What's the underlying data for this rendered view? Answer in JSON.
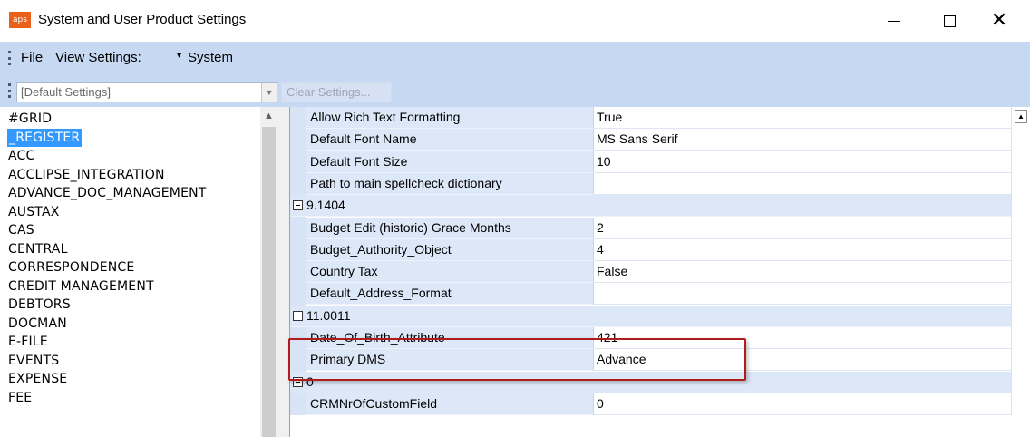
{
  "window": {
    "title": "System and User Product Settings",
    "logo_text": "aps",
    "accent_color": "#e8601c"
  },
  "menubar": {
    "file": "File",
    "view_settings_underlined": "V",
    "view_settings_rest": "iew Settings:",
    "dropdown_arrow": "▾",
    "system": "System"
  },
  "toolbar": {
    "settings_combo_value": "[Default Settings]",
    "clear_settings": "Clear Settings..."
  },
  "products": {
    "items": [
      "#GRID",
      "_REGISTER",
      "ACC",
      "ACCLIPSE_INTEGRATION",
      "ADVANCE_DOC_MANAGEMENT",
      "AUSTAX",
      "CAS",
      "CENTRAL",
      "CORRESPONDENCE",
      "CREDIT MANAGEMENT",
      "DEBTORS",
      "DOCMAN",
      "E-FILE",
      "EVENTS",
      "EXPENSE",
      "FEE"
    ],
    "selected": "_REGISTER"
  },
  "grid": {
    "rows": [
      {
        "name": "Allow Rich Text Formatting",
        "value": "True"
      },
      {
        "name": "Default Font Name",
        "value": "MS Sans Serif"
      },
      {
        "name": "Default Font Size",
        "value": "10"
      },
      {
        "name": "Path to main spellcheck dictionary",
        "value": ""
      },
      {
        "category": "9.1404"
      },
      {
        "name": "Budget Edit (historic) Grace Months",
        "value": "2"
      },
      {
        "name": "Budget_Authority_Object",
        "value": "4"
      },
      {
        "name": "Country Tax",
        "value": "False"
      },
      {
        "name": "Default_Address_Format",
        "value": ""
      },
      {
        "category": "11.0011"
      },
      {
        "name": "Date_Of_Birth_Attribute",
        "value": "421"
      },
      {
        "name": "Primary DMS",
        "value": "Advance"
      },
      {
        "category": "0"
      },
      {
        "name": "CRMNrOfCustomField",
        "value": "0"
      }
    ]
  },
  "icons": {
    "minimize": "minimize-icon",
    "maximize": "maximize-icon",
    "close": "close-icon",
    "close_glyph": "✕",
    "combo_arrow": "▼",
    "scroll_up": "▲",
    "scroll_up_small": "▲"
  },
  "highlight_color": "#b01c1c"
}
